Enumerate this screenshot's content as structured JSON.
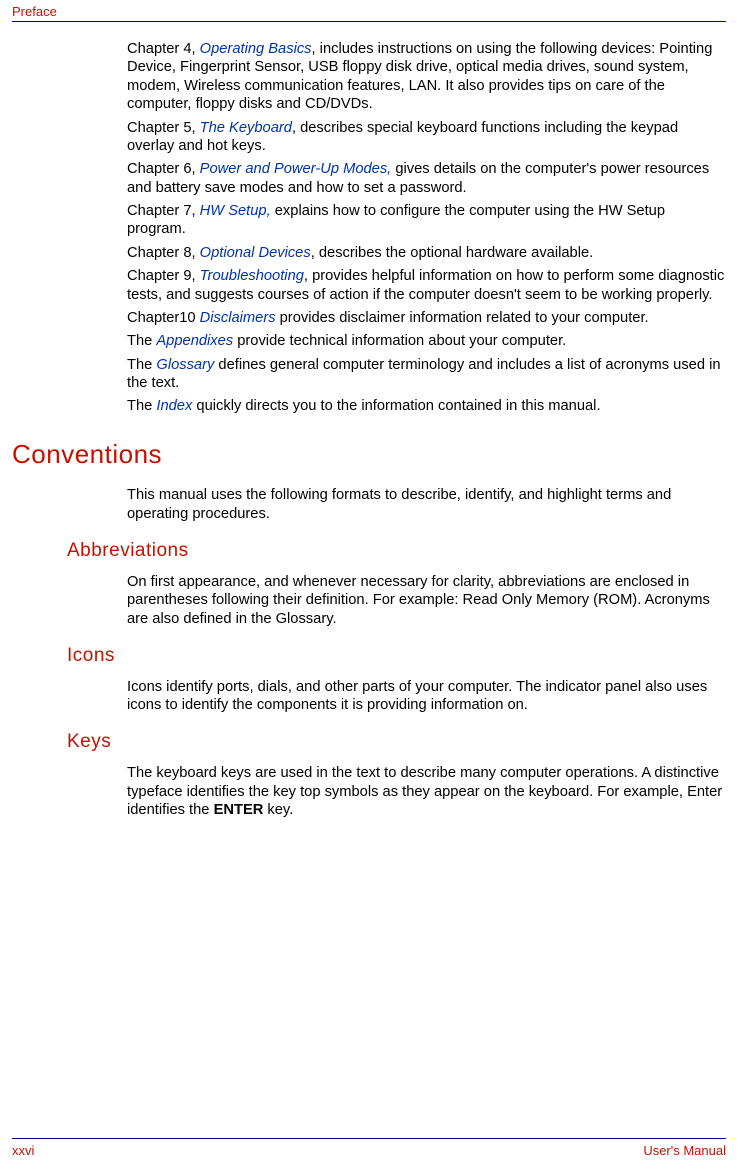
{
  "header": {
    "section": "Preface"
  },
  "paragraphs": {
    "ch4_a": "Chapter 4, ",
    "ch4_link": "Operating Basics",
    "ch4_b": ", includes instructions on using the following devices: Pointing Device, Fingerprint Sensor, USB floppy disk drive, optical media drives, sound system, modem, Wireless communication features, LAN. It also provides tips on care of the computer, floppy disks and CD/DVDs.",
    "ch5_a": "Chapter 5, ",
    "ch5_link": "The Keyboard",
    "ch5_b": ", describes special keyboard functions including the keypad overlay and hot keys.",
    "ch6_a": "Chapter 6, ",
    "ch6_link": "Power and Power-Up Modes,",
    "ch6_b": " gives details on the computer's power resources and battery save modes and how to set a password.",
    "ch7_a": "Chapter 7, ",
    "ch7_link": "HW Setup,",
    "ch7_b": " explains how to configure the computer using the HW Setup program.",
    "ch8_a": "Chapter 8, ",
    "ch8_link": "Optional Devices",
    "ch8_b": ", describes the optional hardware available.",
    "ch9_a": "Chapter 9, ",
    "ch9_link": "Troubleshooting",
    "ch9_b": ", provides helpful information on how to perform some diagnostic tests, and suggests courses of action if the computer doesn't seem to be working properly.",
    "ch10_a": "Chapter10 ",
    "ch10_link": "Disclaimers",
    "ch10_b": " provides disclaimer information related to your computer.",
    "appx_a": "The ",
    "appx_link": "Appendixes",
    "appx_b": " provide technical information about your computer.",
    "glos_a": "The ",
    "glos_link": "Glossary",
    "glos_b": " defines general computer terminology and includes a list of acronyms used in the text.",
    "idx_a": "The ",
    "idx_link": "Index",
    "idx_b": " quickly directs you to the information contained in this manual."
  },
  "headings": {
    "conventions": "Conventions",
    "abbreviations": "Abbreviations",
    "icons": "Icons",
    "keys": "Keys"
  },
  "sections": {
    "conventions_p": "This manual uses the following formats to describe, identify, and highlight terms and operating procedures.",
    "abbreviations_p": "On first appearance, and whenever necessary for clarity, abbreviations are enclosed in parentheses following their definition. For example: Read Only Memory (ROM). Acronyms are also defined in the Glossary.",
    "icons_p": "Icons identify ports, dials, and other parts of your computer. The indicator panel also uses icons to identify the components it is providing information on.",
    "keys_p_a": "The keyboard keys are used in the text to describe many computer operations. A distinctive typeface identifies the key top symbols as they appear on the keyboard. For example, Enter identifies the ",
    "keys_p_bold": "ENTER",
    "keys_p_b": " key."
  },
  "footer": {
    "page": "xxvi",
    "manual": "User's Manual"
  }
}
